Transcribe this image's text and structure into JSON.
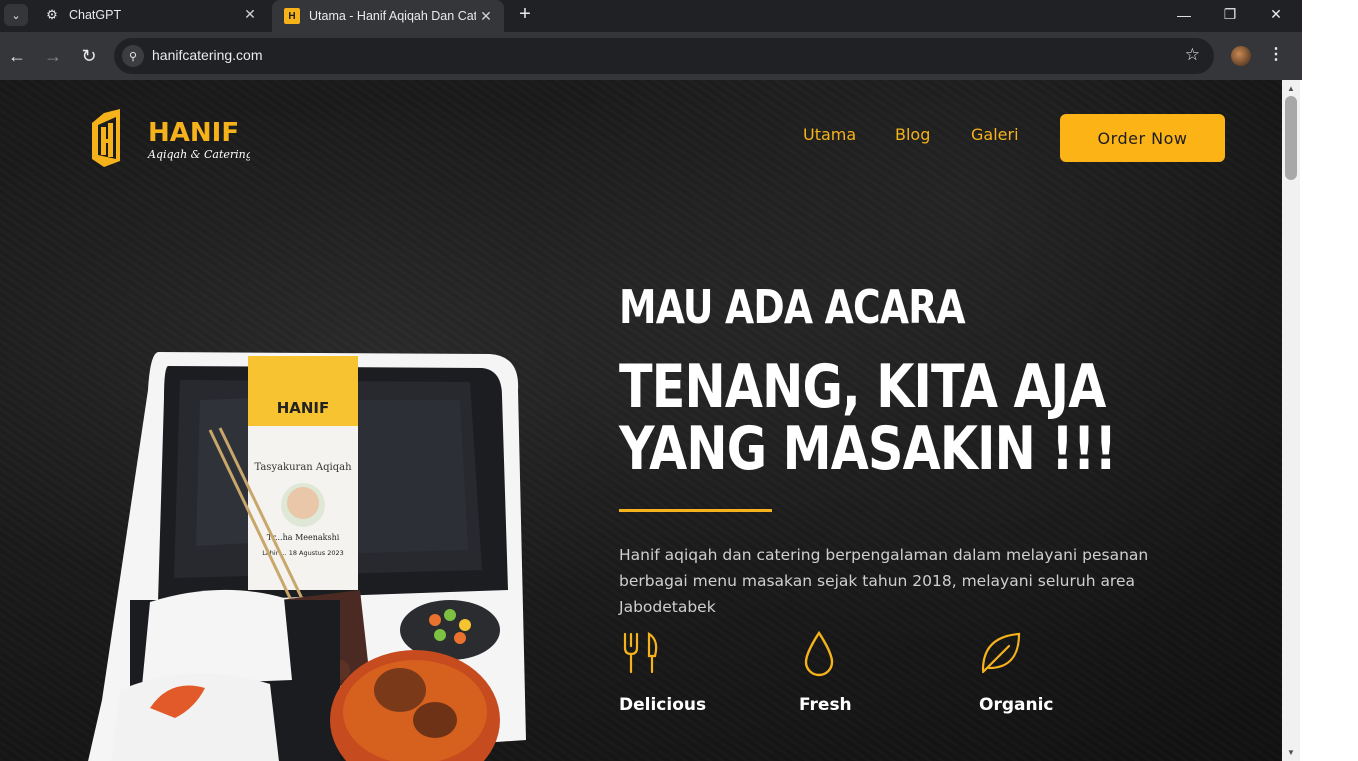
{
  "browser": {
    "tabs": [
      {
        "title": "ChatGPT",
        "icon": "chatgpt-icon",
        "active": false
      },
      {
        "title": "Utama - Hanif Aqiqah Dan Cate",
        "icon": "hanif-favicon",
        "active": true
      }
    ],
    "url": "hanifcatering.com"
  },
  "site": {
    "logo_text": "HANIF",
    "logo_tagline": "Aqiqah & Catering",
    "nav": [
      "Utama",
      "Blog",
      "Galeri"
    ],
    "cta": "Order Now",
    "hero": {
      "subtitle": "MAU ADA ACARA",
      "headline_1": "TENANG, KITA AJA",
      "headline_2": "YANG MASAKIN !!!",
      "description": "Hanif aqiqah dan catering berpengalaman dalam melayani pesanan berbagai menu masakan sejak tahun 2018, melayani seluruh area Jabodetabek"
    },
    "features": [
      {
        "label": "Delicious",
        "icon": "fork-knife-icon"
      },
      {
        "label": "Fresh",
        "icon": "droplet-icon"
      },
      {
        "label": "Organic",
        "icon": "leaf-icon"
      }
    ],
    "accent_color": "#f6b21b",
    "food_card": {
      "brand": "HANIF",
      "title": "Tasyakuran Aqiqah",
      "name": "Tr...ha Meenakshi",
      "date": "Lahir ... 18 Agustus 2023"
    }
  }
}
